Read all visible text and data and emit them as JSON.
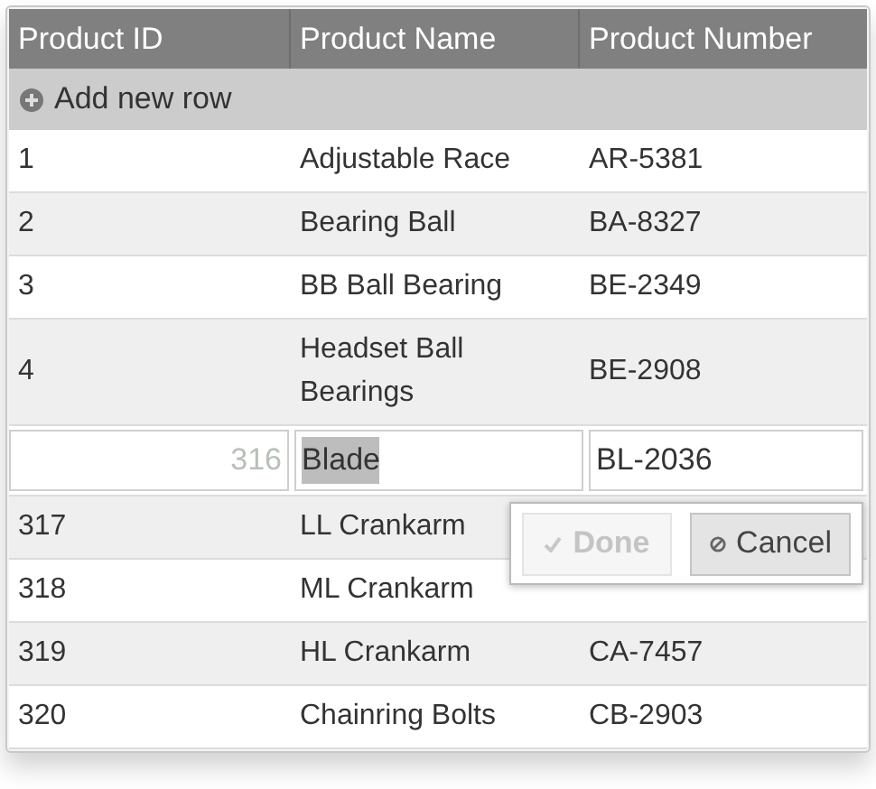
{
  "columns": [
    "Product ID",
    "Product Name",
    "Product Number"
  ],
  "add_row": {
    "label": "Add new row"
  },
  "rows": [
    {
      "kind": "view",
      "id": "1",
      "name": "Adjustable Race",
      "number": "AR-5381"
    },
    {
      "kind": "view",
      "id": "2",
      "name": "Bearing Ball",
      "number": "BA-8327"
    },
    {
      "kind": "view",
      "id": "3",
      "name": "BB Ball Bearing",
      "number": "BE-2349"
    },
    {
      "kind": "view",
      "id": "4",
      "name": "Headset Ball Bearings",
      "number": "BE-2908"
    },
    {
      "kind": "edit",
      "id": "316",
      "name": "Blade",
      "number": "BL-2036",
      "id_disabled": true,
      "name_text_selected": true
    },
    {
      "kind": "view",
      "id": "317",
      "name": "LL Crankarm"
    },
    {
      "kind": "view",
      "id": "318",
      "name": "ML Crankarm"
    },
    {
      "kind": "view",
      "id": "319",
      "name": "HL Crankarm",
      "number": "CA-7457"
    },
    {
      "kind": "view",
      "id": "320",
      "name": "Chainring Bolts",
      "number": "CB-2903"
    }
  ],
  "edit_popup": {
    "buttons": [
      {
        "kind": "done",
        "label": "Done",
        "disabled": true
      },
      {
        "kind": "cancel",
        "label": "Cancel",
        "disabled": false
      }
    ]
  }
}
